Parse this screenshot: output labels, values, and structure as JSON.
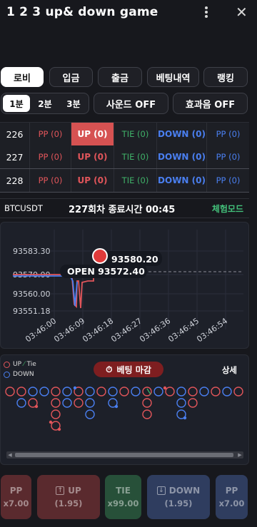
{
  "header": {
    "title": "1 2 3 up& down game",
    "menu_icon": "kebab-menu-icon",
    "close_icon": "close-icon",
    "close_glyph": "✕"
  },
  "nav_tabs": [
    {
      "label": "로비",
      "active": true
    },
    {
      "label": "입금",
      "active": false
    },
    {
      "label": "출금",
      "active": false
    },
    {
      "label": "베팅내역",
      "active": false
    },
    {
      "label": "랭킹",
      "active": false
    }
  ],
  "duration": {
    "options": [
      {
        "label": "1분",
        "active": true
      },
      {
        "label": "2분",
        "active": false
      },
      {
        "label": "3분",
        "active": false
      }
    ]
  },
  "sound_label": "사운드 OFF",
  "effect_label": "효과음 OFF",
  "rounds": [
    {
      "num": "226",
      "pp": "PP (0)",
      "up": "UP (0)",
      "tie": "TIE (0)",
      "down": "DOWN (0)",
      "pp2": "PP (0)",
      "up_hit": true
    },
    {
      "num": "227",
      "pp": "PP (0)",
      "up": "UP (0)",
      "tie": "TIE (0)",
      "down": "DOWN (0)",
      "pp2": "PP (0)",
      "up_hit": false
    },
    {
      "num": "228",
      "pp": "PP (0)",
      "up": "UP (0)",
      "tie": "TIE (0)",
      "down": "DOWN (0)",
      "pp2": "PP (0)",
      "up_hit": false
    }
  ],
  "info": {
    "symbol": "BTCUSDT",
    "round_text": "227회차 종료시간 00:45",
    "demo_label": "체험모드"
  },
  "price_chart": {
    "current_price": "93580.20",
    "open_label": "OPEN 93572.40",
    "y_ticks": [
      "93583.30",
      "93570.00",
      "93560.00",
      "93551.18"
    ],
    "x_ticks": [
      "03:46:00",
      "03:46:09",
      "03:46:18",
      "03:46:27",
      "03:46:36",
      "03:46:45",
      "03:46:54"
    ],
    "colors": {
      "up": "#e0555a",
      "down": "#4a7ff0",
      "grid": "#2a2e3a"
    }
  },
  "bead": {
    "legend_up": "UP",
    "legend_tie": "Tie",
    "legend_down": "DOWN",
    "closing_label": "베팅 마감",
    "closing_icon": "stopwatch-icon",
    "detail_label": "상세",
    "colors": {
      "up": "#e0555a",
      "down": "#4a7ff0",
      "tie": "#3fb068"
    }
  },
  "bets": [
    {
      "key": "pp",
      "line1": "PP",
      "line2": "x7.00",
      "icon": ""
    },
    {
      "key": "up",
      "line1": "UP",
      "line2": "(1.95)",
      "icon": "arrow-up-box-icon"
    },
    {
      "key": "tie",
      "line1": "TIE",
      "line2": "x99.00",
      "icon": ""
    },
    {
      "key": "down",
      "line1": "DOWN",
      "line2": "(1.95)",
      "icon": "arrow-down-box-icon"
    },
    {
      "key": "pp2",
      "line1": "PP",
      "line2": "x7.00",
      "icon": ""
    }
  ]
}
